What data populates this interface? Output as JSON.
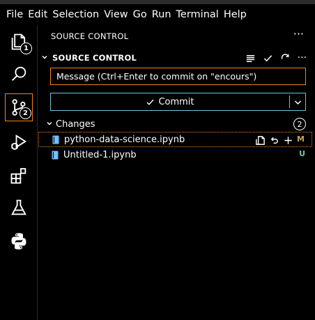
{
  "menu": [
    "File",
    "Edit",
    "Selection",
    "View",
    "Go",
    "Run",
    "Terminal",
    "Help"
  ],
  "activity": {
    "explorer_badge": "1",
    "scm_badge": "2"
  },
  "sidebar": {
    "title": "SOURCE CONTROL",
    "more": "···"
  },
  "scm": {
    "title": "SOURCE CONTROL",
    "more": "···",
    "message_placeholder": "Message (Ctrl+Enter to commit on \"encours\")",
    "commit_label": "Commit",
    "changes_label": "Changes",
    "changes_count": "2",
    "files": [
      {
        "name": "python-data-science.ipynb",
        "status": "M",
        "status_color": "#c6a36b"
      },
      {
        "name": "Untitled-1.ipynb",
        "status": "U",
        "status_color": "#73c991"
      }
    ]
  },
  "colors": {
    "focus": "#f38518",
    "button_border": "#6fc3df",
    "notebook_icon": "#75beff"
  }
}
